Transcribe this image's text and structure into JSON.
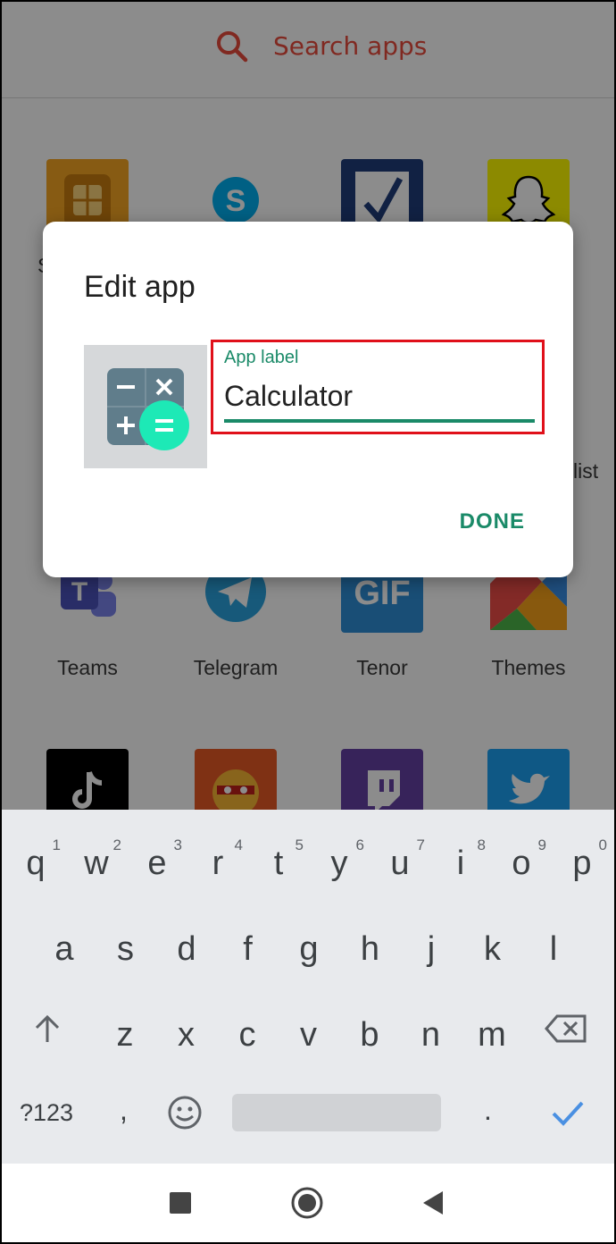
{
  "search": {
    "placeholder": "Search apps"
  },
  "apps_top": [
    {
      "icon": "sim-icon",
      "color": "#f6a623"
    },
    {
      "icon": "skype-icon",
      "color": "#ffffff"
    },
    {
      "icon": "checkmark-app-icon",
      "color": "#ffffff"
    },
    {
      "icon": "snapchat-icon",
      "color": "#fffc00"
    }
  ],
  "partial_labels": {
    "left": "S",
    "right": "list"
  },
  "apps_middle": [
    {
      "name": "Teams",
      "icon": "teams-icon",
      "color": "#ffffff"
    },
    {
      "name": "Telegram",
      "icon": "telegram-icon",
      "color": "#ffffff"
    },
    {
      "name": "Tenor",
      "icon": "gif-icon",
      "color": "#2e8fd8"
    },
    {
      "name": "Themes",
      "icon": "themes-icon",
      "color": "#ffffff"
    }
  ],
  "apps_bottom": [
    {
      "icon": "tiktok-icon",
      "color": "#000000"
    },
    {
      "icon": "talking-tom-icon",
      "color": "#e85a26"
    },
    {
      "icon": "twitch-icon",
      "color": "#6441a5"
    },
    {
      "icon": "twitter-icon",
      "color": "#1da1f2"
    }
  ],
  "dialog": {
    "title": "Edit app",
    "field_label": "App label",
    "field_value": "Calculator",
    "done_label": "DONE",
    "accent": "#1a8a68",
    "highlight": "#e0101a"
  },
  "keyboard": {
    "row1": [
      {
        "ch": "q",
        "num": "1"
      },
      {
        "ch": "w",
        "num": "2"
      },
      {
        "ch": "e",
        "num": "3"
      },
      {
        "ch": "r",
        "num": "4"
      },
      {
        "ch": "t",
        "num": "5"
      },
      {
        "ch": "y",
        "num": "6"
      },
      {
        "ch": "u",
        "num": "7"
      },
      {
        "ch": "i",
        "num": "8"
      },
      {
        "ch": "o",
        "num": "9"
      },
      {
        "ch": "p",
        "num": "0"
      }
    ],
    "row2": [
      "a",
      "s",
      "d",
      "f",
      "g",
      "h",
      "j",
      "k",
      "l"
    ],
    "row3": [
      "z",
      "x",
      "c",
      "v",
      "b",
      "n",
      "m"
    ],
    "symbols_key": "?123",
    "comma": ",",
    "period": "."
  }
}
